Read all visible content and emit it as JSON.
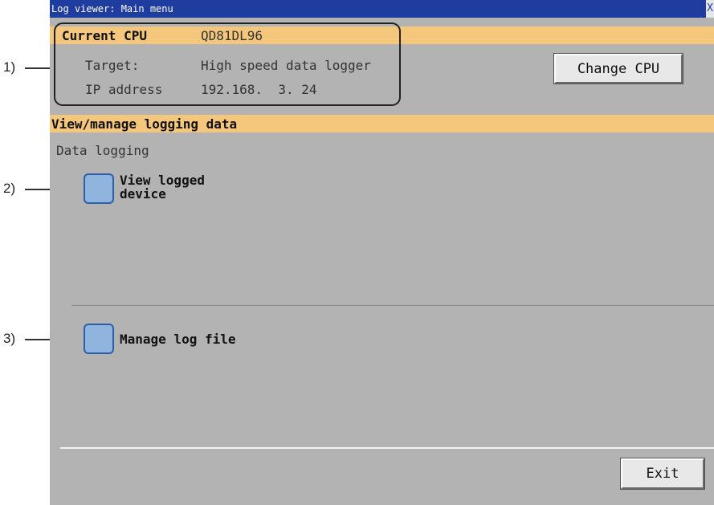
{
  "annotations": [
    "1)",
    "2)",
    "3)"
  ],
  "window": {
    "title": "Log viewer: Main menu",
    "close_glyph": "X"
  },
  "cpu_info": {
    "current_cpu_label": "Current CPU",
    "current_cpu_value": "QD81DL96",
    "target_label": "Target:",
    "target_value": "High speed data logger",
    "ip_label": "IP address",
    "ip_value": "192.168.  3. 24"
  },
  "change_cpu_button": "Change CPU",
  "section": {
    "header": "View/manage logging data",
    "data_logging_label": "Data logging"
  },
  "menu": {
    "view_logged_device": [
      "View logged",
      "device"
    ],
    "manage_log_file": "Manage log file"
  },
  "exit_button": "Exit",
  "colors": {
    "titlebar": "#1f3d9e",
    "header_band": "#f5c77d",
    "screen_bg": "#b3b3b3",
    "square_button": "#8fb5de"
  }
}
